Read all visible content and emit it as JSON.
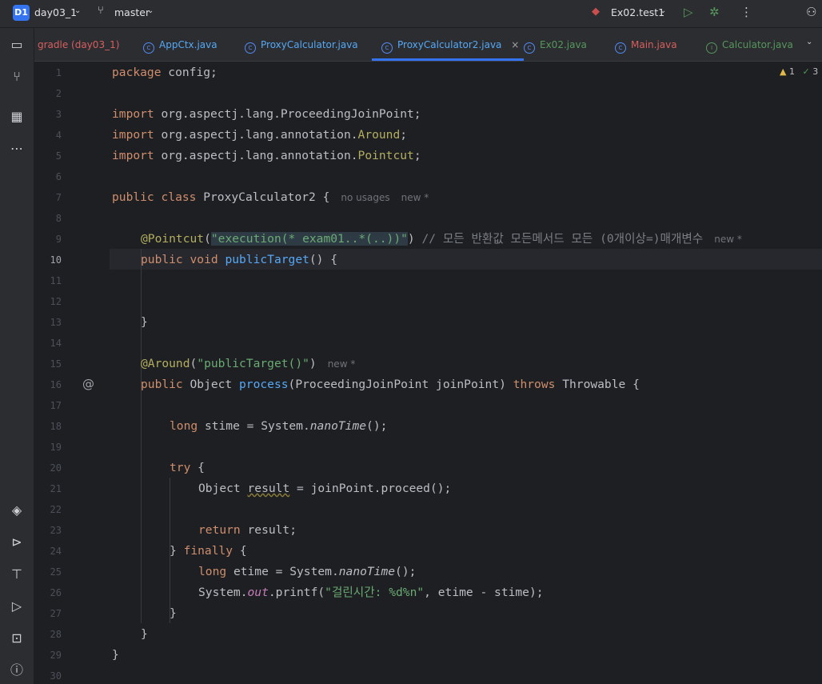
{
  "titlebar": {
    "project_badge": "D1",
    "project_name": "day03_1",
    "branch": "master",
    "run_config": "Ex02.test1"
  },
  "tabs": [
    {
      "label": "gradle (day03_1)"
    },
    {
      "label": "AppCtx.java"
    },
    {
      "label": "ProxyCalculator.java"
    },
    {
      "label": "ProxyCalculator2.java"
    },
    {
      "label": "Ex02.java"
    },
    {
      "label": "Main.java"
    },
    {
      "label": "Calculator.java"
    }
  ],
  "inspections": {
    "warnings": "1",
    "checks": "3"
  },
  "gutter": {
    "implements_marker": "@"
  },
  "line_numbers": [
    "1",
    "2",
    "3",
    "4",
    "5",
    "6",
    "7",
    "8",
    "9",
    "10",
    "11",
    "12",
    "13",
    "14",
    "15",
    "16",
    "17",
    "18",
    "19",
    "20",
    "21",
    "22",
    "23",
    "24",
    "25",
    "26",
    "27",
    "28",
    "29",
    "30"
  ],
  "code": {
    "l1_kw": "package",
    "l1_rest": " config;",
    "l3_kw": "import",
    "l3_rest": " org.aspectj.lang.ProceedingJoinPoint;",
    "l4_kw": "import",
    "l4_rest": " org.aspectj.lang.annotation.",
    "l4_ann": "Around",
    "l4_end": ";",
    "l5_kw": "import",
    "l5_rest": " org.aspectj.lang.annotation.",
    "l5_ann": "Pointcut",
    "l5_end": ";",
    "l7_kw": "public class",
    "l7_rest": " ProxyCalculator2 {",
    "l7_hint1": "no usages",
    "l7_hint2": "new *",
    "l9_ann": "@Pointcut",
    "l9_p1": "(",
    "l9_str": "\"execution(* exam01..*(..))\"",
    "l9_p2": ")",
    "l9_cmt": " // 모든 반환값 모든메서드 모든 (0개이상=)매개변수",
    "l9_hint": "new *",
    "l10_kw": "public void",
    "l10_fn": "publicTarget",
    "l10_rest": "() {",
    "l13_rest": "}",
    "l15_ann": "@Around",
    "l15_p1": "(",
    "l15_str": "\"publicTarget()\"",
    "l15_p2": ")",
    "l15_hint": "new *",
    "l16_kw": "public",
    "l16_rest1": " Object ",
    "l16_fn": "process",
    "l16_rest2": "(ProceedingJoinPoint joinPoint) ",
    "l16_kw2": "throws",
    "l16_rest3": " Throwable {",
    "l18_kw": "long",
    "l18_rest1": " stime = System.",
    "l18_it": "nanoTime",
    "l18_rest2": "();",
    "l20_kw": "try",
    "l20_rest": " {",
    "l21_rest1": "Object ",
    "l21_u": "result",
    "l21_rest2": " = joinPoint.proceed();",
    "l23_kw": "return",
    "l23_rest": " result;",
    "l24_rest1": "} ",
    "l24_kw": "finally",
    "l24_rest2": " {",
    "l25_kw": "long",
    "l25_rest1": " etime = System.",
    "l25_it": "nanoTime",
    "l25_rest2": "();",
    "l26_rest1": "System.",
    "l26_fld": "out",
    "l26_rest2": ".printf(",
    "l26_str": "\"걸린시간: %d%n\"",
    "l26_rest3": ", etime - stime);",
    "l27_rest": "}",
    "l28_rest": "}",
    "l29_rest": "}"
  },
  "colors": {
    "accent": "#3574f0",
    "keyword": "#cf8e6d",
    "annotation": "#b3ae60",
    "string": "#6aab73",
    "function": "#56a8f5"
  }
}
